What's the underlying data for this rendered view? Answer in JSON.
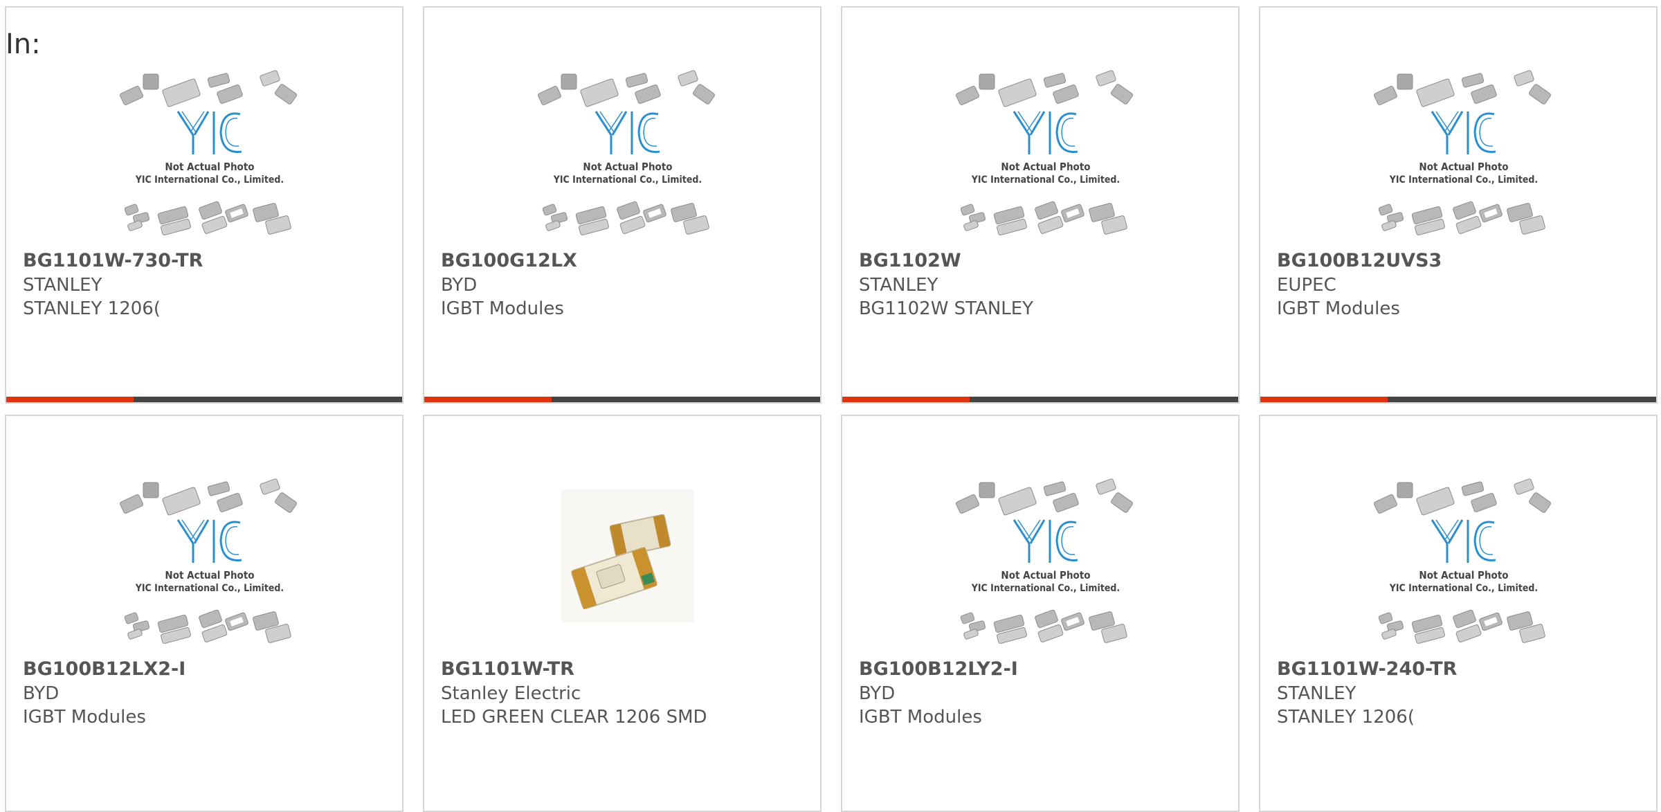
{
  "header": {
    "filter_label": "In:"
  },
  "colors": {
    "card_border": "#d6d6d6",
    "bar_dark": "#444444",
    "bar_accent": "#e03410",
    "logo_blue": "#2a8fcf",
    "text": "#555555"
  },
  "placeholder": {
    "line1": "Not Actual Photo",
    "line2": "YIC International Co., Limited.",
    "logo_text": "YIC"
  },
  "products": [
    {
      "part": "BG1101W-730-TR",
      "manufacturer": "STANLEY",
      "description": "STANLEY 1206(",
      "image": "placeholder"
    },
    {
      "part": "BG100G12LX",
      "manufacturer": "BYD",
      "description": "IGBT Modules",
      "image": "placeholder"
    },
    {
      "part": "BG1102W",
      "manufacturer": "STANLEY",
      "description": "BG1102W STANLEY",
      "image": "placeholder"
    },
    {
      "part": "BG100B12UVS3",
      "manufacturer": "EUPEC",
      "description": "IGBT Modules",
      "image": "placeholder"
    },
    {
      "part": "BG100B12LX2-I",
      "manufacturer": "BYD",
      "description": "IGBT Modules",
      "image": "placeholder"
    },
    {
      "part": "BG1101W-TR",
      "manufacturer": "Stanley Electric",
      "description": "LED GREEN CLEAR 1206 SMD",
      "image": "led-photo"
    },
    {
      "part": "BG100B12LY2-I",
      "manufacturer": "BYD",
      "description": "IGBT Modules",
      "image": "placeholder"
    },
    {
      "part": "BG1101W-240-TR",
      "manufacturer": "STANLEY",
      "description": "STANLEY 1206(",
      "image": "placeholder"
    }
  ]
}
